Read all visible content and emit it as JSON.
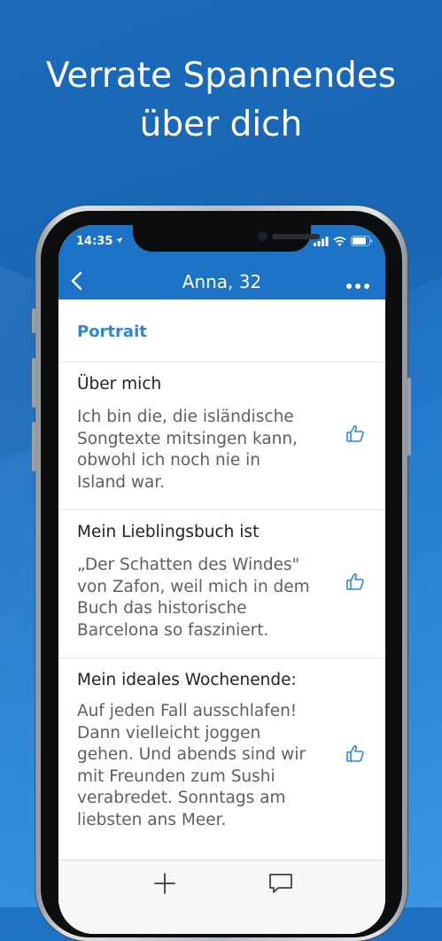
{
  "promo": {
    "headline_line1": "Verrate Spannendes",
    "headline_line2": "über dich"
  },
  "status_bar": {
    "time": "14:35",
    "icons": [
      "location-arrow-icon",
      "signal-icon",
      "wifi-icon",
      "battery-icon"
    ]
  },
  "nav": {
    "title": "Anna, 32",
    "back_icon": "chevron-left-icon",
    "more_icon": "more-dots-icon"
  },
  "portrait": {
    "label": "Portrait"
  },
  "sections": [
    {
      "title": "Über mich",
      "text": "Ich bin die, die isländische\nSongtexte mitsingen kann,\nobwohl ich noch nie in\nIsland war.",
      "action_icon": "thumbs-up-icon"
    },
    {
      "title": "Mein Lieblingsbuch ist",
      "text": "„Der Schatten des Windes\"\nvon Zafon, weil mich in dem\nBuch das historische\nBarcelona so fasziniert.",
      "action_icon": "thumbs-up-icon"
    },
    {
      "title": "Mein ideales Wochenende:",
      "text": "Auf jeden Fall ausschlafen!\nDann vielleicht joggen\ngehen. Und abends sind wir\nmit Freunden zum Sushi\nverabredet. Sonntags am\nliebsten ans Meer.",
      "action_icon": "thumbs-up-icon"
    }
  ],
  "tabbar": {
    "icons": [
      "plus-icon",
      "chat-bubble-icon"
    ]
  },
  "colors": {
    "brand_blue": "#1c72c4",
    "accent_blue": "#2c88d3",
    "text_dark": "#222222",
    "text_gray": "#5c6066"
  }
}
